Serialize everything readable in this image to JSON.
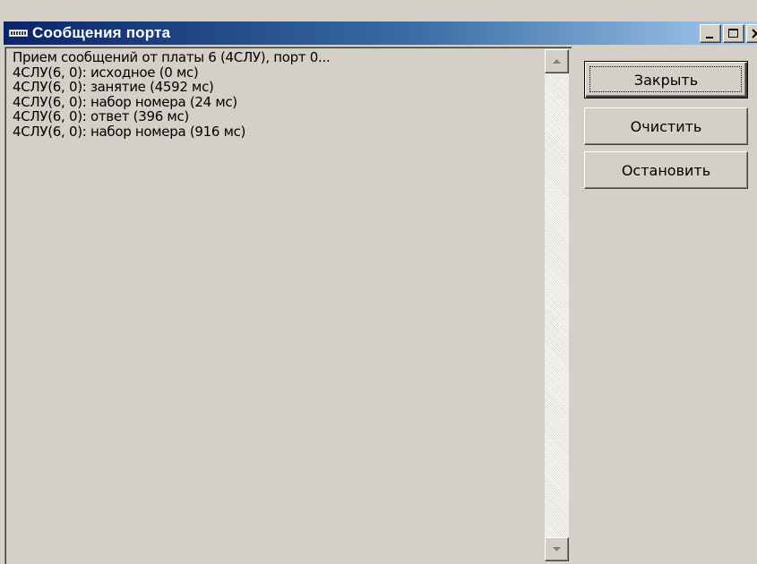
{
  "window": {
    "title": "Сообщения порта",
    "icon": "port-monitor-icon",
    "caption_buttons": [
      "minimize-icon",
      "maximize-icon",
      "close-icon"
    ]
  },
  "log": {
    "lines": [
      "Прием сообщений от платы 6 (4СЛУ), порт 0...",
      "4СЛУ(6, 0): исходное (0 мс)",
      "4СЛУ(6, 0): занятие (4592 мс)",
      "4СЛУ(6, 0): набор номера (24 мс)",
      "4СЛУ(6, 0): ответ (396 мс)",
      "4СЛУ(6, 0): набор номера (916 мс)"
    ]
  },
  "buttons": {
    "close_label": "Закрыть",
    "clear_label": "Очистить",
    "stop_label": "Остановить"
  },
  "colors": {
    "titlebar_start": "#0a246a",
    "titlebar_end": "#a6caf0",
    "window_face": "#d4d0c8"
  }
}
